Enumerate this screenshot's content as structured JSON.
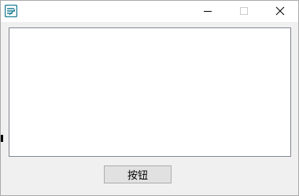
{
  "window": {
    "title": "",
    "icon": "app-icon",
    "controls": {
      "minimize": "minimize-icon",
      "maximize": "maximize-icon",
      "close": "close-icon"
    }
  },
  "main": {
    "text_area_value": "",
    "button_label": "按钮"
  },
  "colors": {
    "client_bg": "#f0f0f0",
    "titlebar_bg": "#ffffff",
    "border": "#828790",
    "button_bg": "#e1e1e1",
    "icon_teal": "#1f7f93"
  }
}
